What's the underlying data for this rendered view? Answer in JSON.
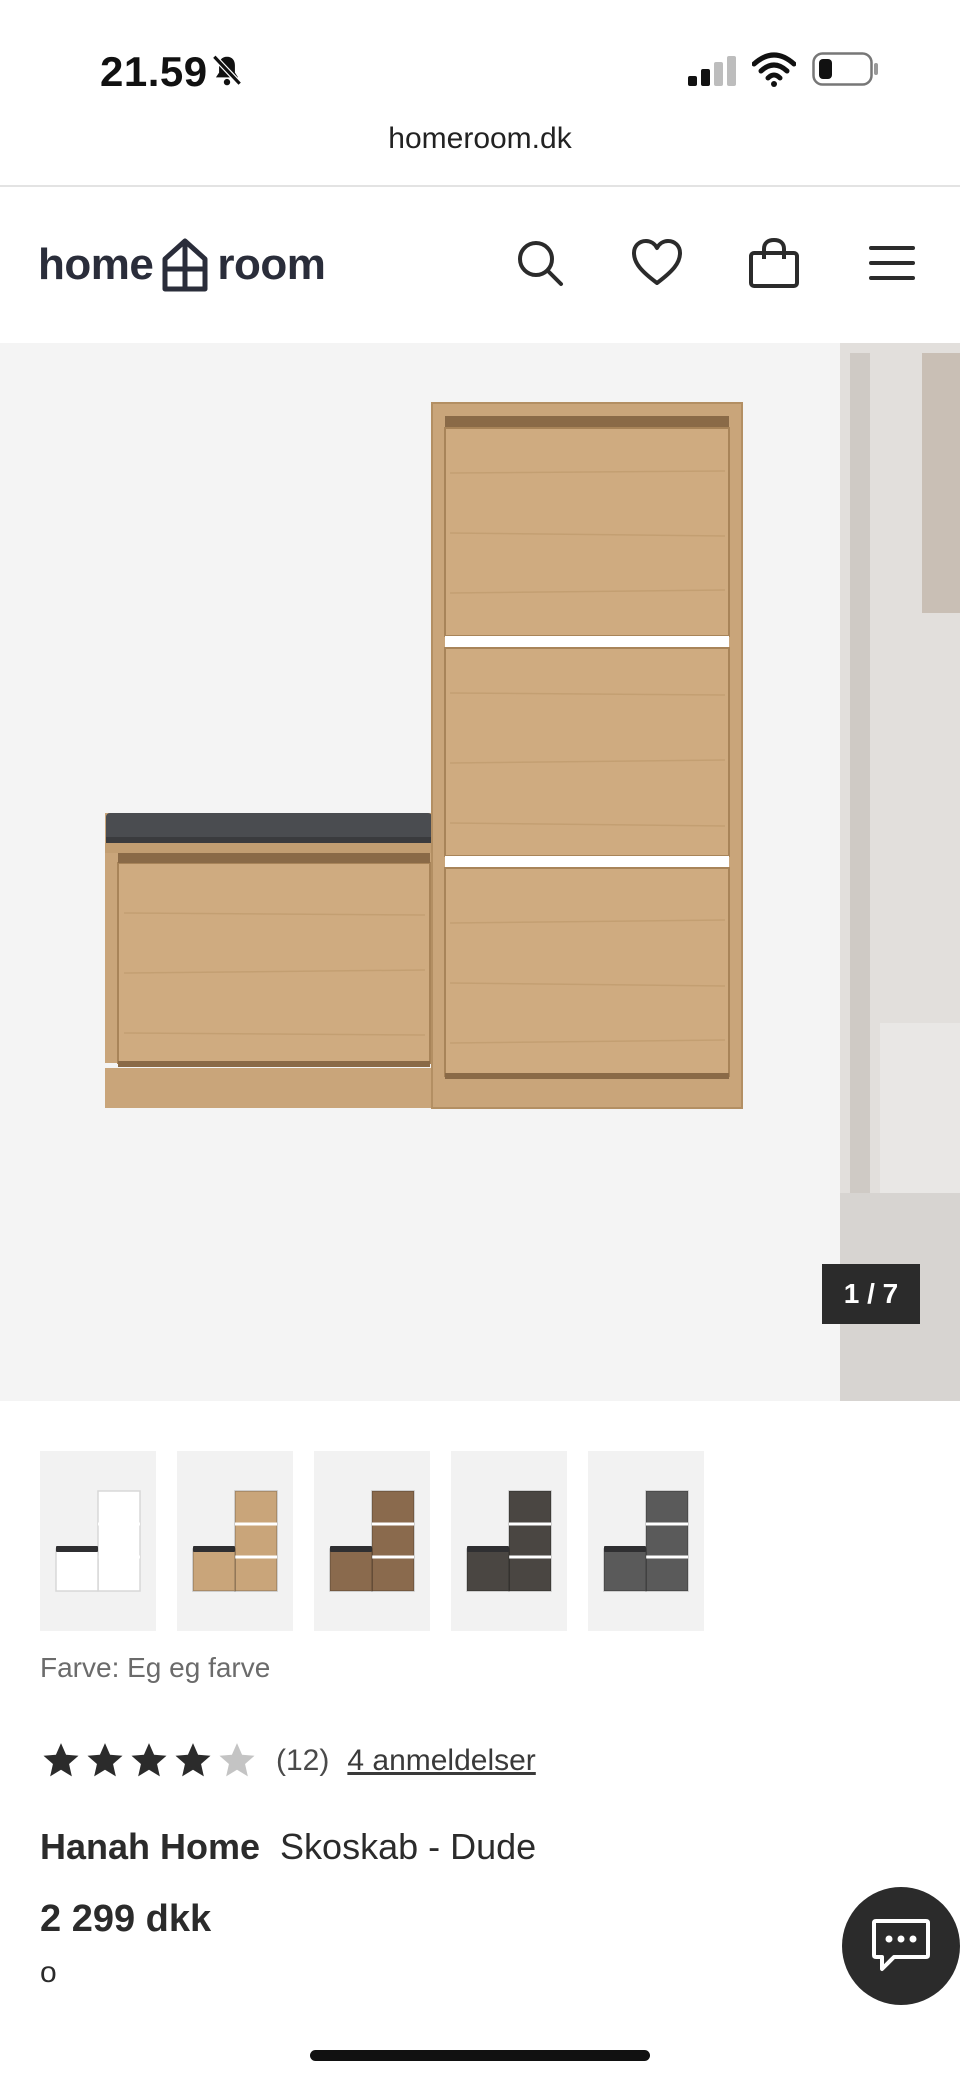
{
  "status_bar": {
    "time": "21.59"
  },
  "browser": {
    "url": "homeroom.dk"
  },
  "header": {
    "logo_left": "home",
    "logo_right": "room",
    "icons": [
      "search-icon",
      "heart-icon",
      "bag-icon",
      "menu-icon"
    ]
  },
  "gallery": {
    "counter": "1 / 7"
  },
  "variants": [
    {
      "name": "white",
      "color": "#f2f2f2"
    },
    {
      "name": "oak",
      "color": "#c9a57a"
    },
    {
      "name": "walnut",
      "color": "#8a6a4d"
    },
    {
      "name": "dark-brown",
      "color": "#4a4642"
    },
    {
      "name": "anthracite",
      "color": "#5a5a5a"
    }
  ],
  "product": {
    "color_label": "Farve: Eg eg farve",
    "rating": 4,
    "rating_count": "(12)",
    "reviews_link": "4 anmeldelser",
    "brand": "Hanah Home",
    "name": "Skoskab - Dude",
    "price": "2 299 dkk",
    "sub": "o"
  },
  "colors": {
    "wood": "#c9a57a",
    "dark": "#2b2b2b",
    "cushion": "#4a4c50",
    "star_filled": "#2b2b2b",
    "star_empty": "#c4c4c4"
  }
}
